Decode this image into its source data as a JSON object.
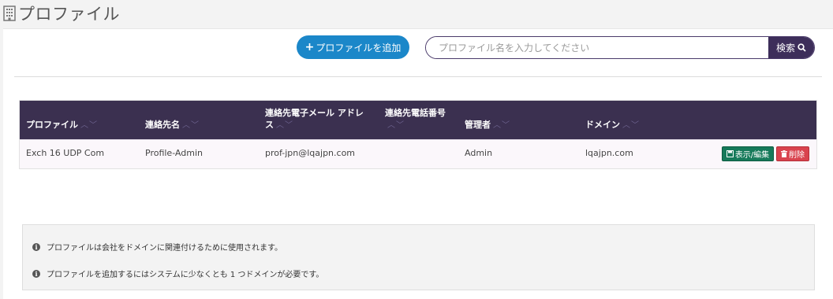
{
  "page": {
    "title": "プロファイル",
    "icon": "building-icon"
  },
  "toolbar": {
    "add_label": "プロファイルを追加",
    "search_placeholder": "プロファイル名を入力してください",
    "search_label": "検索"
  },
  "table": {
    "sort_indicator": "︿﹀",
    "columns": [
      {
        "label": "プロファイル"
      },
      {
        "label": "連絡先名"
      },
      {
        "label": "連絡先電子メール アドレス"
      },
      {
        "label": "連絡先電話番号"
      },
      {
        "label": "管理者"
      },
      {
        "label": "ドメイン"
      }
    ],
    "rows": [
      {
        "profile": "Exch 16 UDP Com",
        "contact_name": "Profile-Admin",
        "email": "prof-jpn@lqajpn.com",
        "phone": "",
        "admin": "Admin",
        "domain": "lqajpn.com",
        "edit_label": "表示/編集",
        "delete_label": "削除"
      }
    ]
  },
  "info": {
    "lines": [
      "プロファイルは会社をドメインに関連付けるために使用されます。",
      "プロファイルを追加するにはシステムに少なくとも 1 つドメインが必要です。"
    ]
  },
  "colors": {
    "header_bg": "#3b3050",
    "add_button": "#1b87c9",
    "search_button": "#3d2e5a",
    "edit_button": "#167a5a",
    "delete_button": "#d9434e"
  }
}
